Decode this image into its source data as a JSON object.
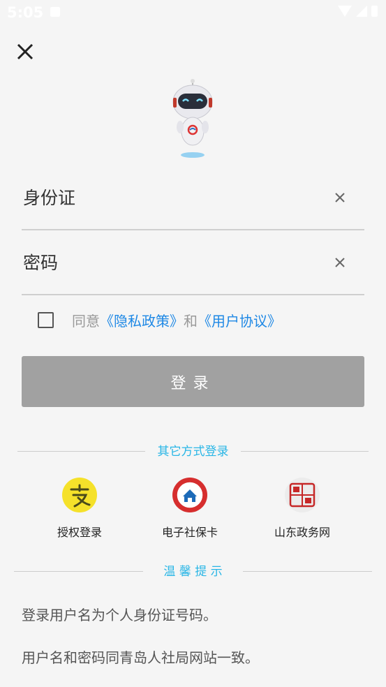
{
  "status": {
    "time": "5:05"
  },
  "fields": {
    "id_placeholder": "身份证",
    "password_placeholder": "密码"
  },
  "agreement": {
    "prefix": "同意",
    "privacy": "《隐私政策》",
    "and": "和",
    "terms": "《用户协议》"
  },
  "login_label": "登录",
  "other_methods": {
    "title": "其它方式登录",
    "items": [
      {
        "label": "授权登录",
        "icon": "alipay-icon"
      },
      {
        "label": "电子社保卡",
        "icon": "social-security-card-icon"
      },
      {
        "label": "山东政务网",
        "icon": "shandong-gov-icon"
      }
    ]
  },
  "tips": {
    "title": "温 馨 提 示",
    "lines": [
      "登录用户名为个人身份证号码。",
      "用户名和密码同青岛人社局网站一致。"
    ]
  },
  "colors": {
    "accent": "#29b6e6",
    "link": "#1e88e5",
    "login_button": "#a1a1a1",
    "alipay_yellow": "#f5e12a",
    "seal_red": "#d62e2e"
  }
}
